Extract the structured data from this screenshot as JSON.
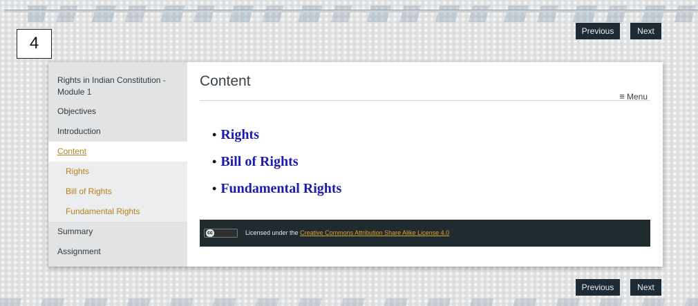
{
  "slide_number": "4",
  "nav": {
    "previous_label": "Previous",
    "next_label": "Next"
  },
  "sidebar": {
    "title": "Rights in Indian Constitution - Module 1",
    "items": [
      {
        "label": "Objectives"
      },
      {
        "label": "Introduction"
      },
      {
        "label": "Content"
      },
      {
        "label": "Rights"
      },
      {
        "label": "Bill of Rights"
      },
      {
        "label": "Fundamental Rights"
      },
      {
        "label": "Summary"
      },
      {
        "label": "Assignment"
      }
    ]
  },
  "main": {
    "title": "Content",
    "menu_label": "Menu",
    "bullets": [
      "Rights",
      "Bill of Rights",
      "Fundamental Rights"
    ]
  },
  "footer": {
    "badge_text": "cc",
    "license_prefix": "Licensed under the ",
    "license_link": "Creative Commons Attribution Share Alike License 4.0"
  },
  "colors": {
    "link_gold": "#b5801f",
    "bullet_blue": "#1b1bb0",
    "dark_button": "#1f2b34"
  }
}
